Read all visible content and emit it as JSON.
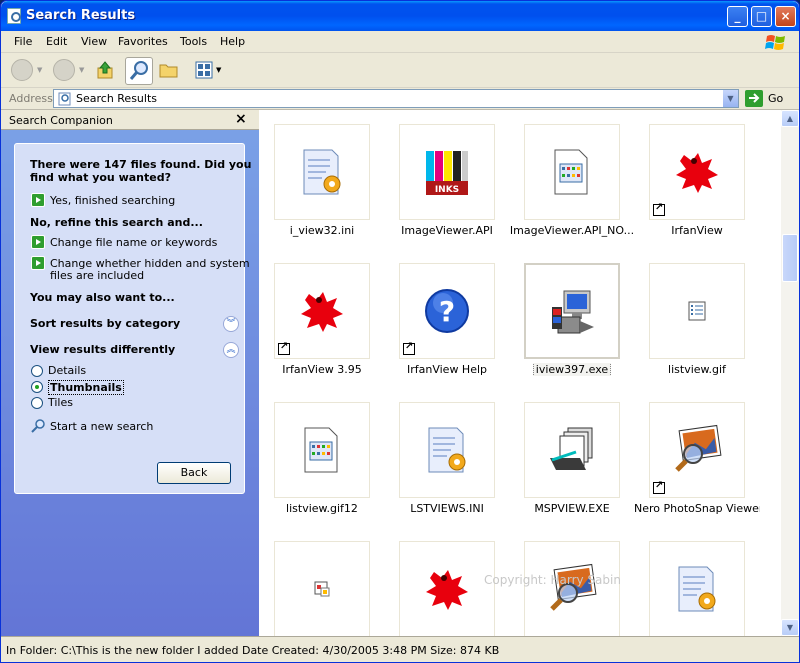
{
  "window": {
    "title": "Search Results",
    "min": "_",
    "max": "□",
    "close": "×"
  },
  "menu": [
    "File",
    "Edit",
    "View",
    "Favorites",
    "Tools",
    "Help"
  ],
  "address": {
    "label": "Address",
    "value": "Search Results",
    "go": "Go"
  },
  "companion": {
    "title": "Search Companion",
    "close": "×",
    "found": [
      "There were 147 files found. Did you",
      "find what you wanted?"
    ],
    "yes": "Yes, finished searching",
    "refine": "No, refine this search and...",
    "change_name": "Change file name or keywords",
    "change_hidden": [
      "Change whether hidden and system",
      "files are included"
    ],
    "also": "You may also want to...",
    "sort": "Sort results by category",
    "view_diff": "View results differently",
    "views": [
      "Details",
      "Thumbnails",
      "Tiles"
    ],
    "selected_view": "Thumbnails",
    "new_search": "Start a new search",
    "back": "Back"
  },
  "files": [
    {
      "name": "i_view32.ini",
      "icon": "ini-icon",
      "shortcut": false
    },
    {
      "name": "ImageViewer.API",
      "icon": "inks-icon",
      "shortcut": false
    },
    {
      "name": "ImageViewer.API_NO...",
      "icon": "image-file-icon",
      "shortcut": false
    },
    {
      "name": "IrfanView",
      "icon": "irfanview-icon",
      "shortcut": true
    },
    {
      "name": "IrfanView 3.95",
      "icon": "irfanview-icon",
      "shortcut": true
    },
    {
      "name": "IrfanView Help",
      "icon": "help-icon",
      "shortcut": true
    },
    {
      "name": "iview397.exe",
      "icon": "installer-icon",
      "shortcut": false,
      "selected": true
    },
    {
      "name": "listview.gif",
      "icon": "list-icon",
      "shortcut": false
    },
    {
      "name": "listview.gif12",
      "icon": "image-file-icon",
      "shortcut": false
    },
    {
      "name": "LSTVIEWS.INI",
      "icon": "ini-icon",
      "shortcut": false
    },
    {
      "name": "MSPVIEW.EXE",
      "icon": "scanner-icon",
      "shortcut": false
    },
    {
      "name": "Nero PhotoSnap Viewer",
      "icon": "photo-magnifier-icon",
      "shortcut": true
    },
    {
      "name": "",
      "icon": "small-image-icon",
      "shortcut": false
    },
    {
      "name": "",
      "icon": "irfanview-icon",
      "shortcut": false
    },
    {
      "name": "",
      "icon": "photo-magnifier-icon",
      "shortcut": false
    },
    {
      "name": "",
      "icon": "ini-icon",
      "shortcut": false
    }
  ],
  "watermark": "Copyright: Harry Sabin",
  "status": "In Folder: C:\\This is the new folder I added Date Created: 4/30/2005 3:48 PM Size: 874 KB"
}
